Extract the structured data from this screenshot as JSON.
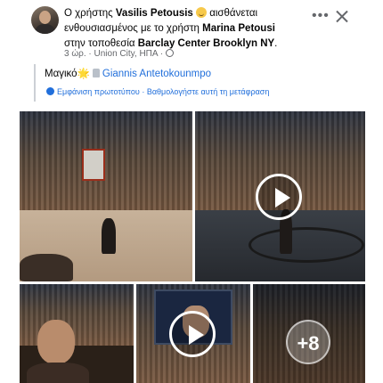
{
  "post": {
    "prefix": "Ο χρήστης ",
    "author": "Vasilis Petousis",
    "feeling": " αισθάνεται ενθουσιασμένος με το χρήστη ",
    "tagged": "Marina Petousi",
    "at_text": " στην τοποθεσία ",
    "location": "Barclay Center Brooklyn NY",
    "period": ".",
    "meta": "3 ώρ. · Union City, ΗΠΑ ·",
    "emoji_icon": "smile-emoji-icon",
    "privacy_icon": "globe-icon"
  },
  "header_actions": {
    "more": "•••",
    "close_icon": "close-icon"
  },
  "content": {
    "text": "Μαγικό",
    "sparkle": "🌟",
    "mention": "Giannis Antetokounmpo",
    "see_original": "Εμφάνιση πρωτοτύπου",
    "separator": " · ",
    "rate_translation": "Βαθμολογήστε αυτή τη μετάφραση"
  },
  "media": {
    "items": [
      {
        "kind": "photo",
        "subject": "basketball game view"
      },
      {
        "kind": "video",
        "subject": "Brooklyn Nets court"
      },
      {
        "kind": "photo",
        "subject": "selfie in arena"
      },
      {
        "kind": "video",
        "subject": "arena screen"
      },
      {
        "kind": "photo",
        "subject": "crowd",
        "more_count": "+8"
      }
    ]
  },
  "colors": {
    "link": "#216fdb",
    "meta_text": "#65676b",
    "text": "#050505"
  }
}
